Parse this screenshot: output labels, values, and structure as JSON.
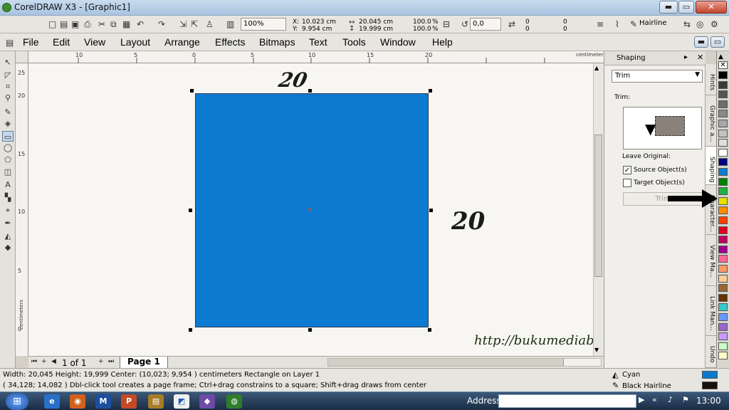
{
  "window": {
    "title": "CorelDRAW X3 - [Graphic1]",
    "min": "▬",
    "max": "▭",
    "close": "✕"
  },
  "propbar": {
    "zoom": "100%",
    "x_label": "X:",
    "x": "10.023 cm",
    "y_label": "Y:",
    "y": "9.954 cm",
    "w": "20.045 cm",
    "h": "19.999 cm",
    "scale_w": "100.0",
    "scale_h": "100.0",
    "pct": "%",
    "rotation": "0,0",
    "corner_values": [
      "0",
      "0",
      "0",
      "0"
    ],
    "outline": "Hairline"
  },
  "menu": [
    "File",
    "Edit",
    "View",
    "Layout",
    "Arrange",
    "Effects",
    "Bitmaps",
    "Text",
    "Tools",
    "Window",
    "Help"
  ],
  "ruler": {
    "h_ticks": [
      "10",
      "5",
      "0",
      "5",
      "10",
      "15",
      "20"
    ],
    "v_ticks": [
      "25",
      "20",
      "15",
      "10",
      "5",
      "0"
    ],
    "units": "centimeters"
  },
  "annotations": {
    "top_dim": "20",
    "side_dim": "20",
    "url": "http://bukumediabook.blogspot.com"
  },
  "pager": {
    "count": "1 of 1",
    "page_tab": "Page 1"
  },
  "docker": {
    "title": "Shaping",
    "mode": "Trim",
    "trim_label": "Trim:",
    "leave_original": "Leave Original:",
    "source": "Source Object(s)",
    "target": "Target Object(s)",
    "button": "Trim"
  },
  "docker_tabs": [
    "Hints",
    "Graphic a...",
    "Shaping",
    "Character...",
    "View Ma...",
    "Link Man...",
    "Undo"
  ],
  "palette": [
    "#ffffff",
    "#000000",
    "#3a3a3a",
    "#555555",
    "#6e6e6e",
    "#8a8a8a",
    "#a7a7a7",
    "#c3c3c3",
    "#dedede",
    "#ffffff",
    "#000080",
    "#0c7ad0",
    "#008000",
    "#20b040",
    "#e8e000",
    "#ff8c00",
    "#ff4000",
    "#e00020",
    "#c00060",
    "#a00090",
    "#ff6699",
    "#ff9966",
    "#ffcc99",
    "#996633",
    "#663300",
    "#33cccc",
    "#6699ff",
    "#9966cc",
    "#cc99ff",
    "#ccffcc",
    "#ffffcc"
  ],
  "status": {
    "line1": "Width: 20,045  Height: 19,999  Center: (10,023; 9,954 )  centimeters Rectangle on Layer 1",
    "line2": "( 34,128; 14,082 )  Dbl-click tool creates a page frame; Ctrl+drag constrains to a square; Shift+drag draws from center",
    "fill_name": "Cyan",
    "outline_name": "Black  Hairline",
    "fill_color": "#0c7ad0",
    "outline_color": "#1a1010"
  },
  "taskbar": {
    "address_label": "Address",
    "time": "13:00"
  }
}
